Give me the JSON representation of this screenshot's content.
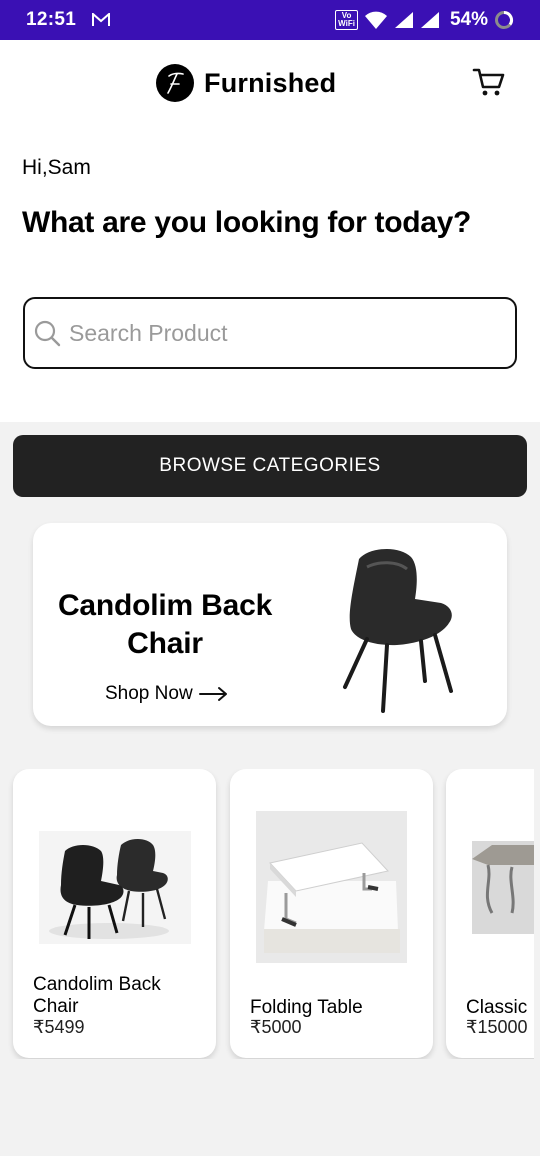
{
  "status_bar": {
    "time": "12:51",
    "network_label_top": "Vo",
    "network_label_bottom": "WiFi",
    "battery": "54%"
  },
  "header": {
    "brand": "Furnished",
    "icons": [
      "furnished-logo-icon",
      "cart-icon"
    ]
  },
  "greeting": "Hi,Sam",
  "headline": "What are you looking for today?",
  "search": {
    "placeholder": "Search Product",
    "value": ""
  },
  "browse_button": "BROWSE CATEGORIES",
  "banner": {
    "title": "Candolim Back Chair",
    "cta": "Shop Now"
  },
  "products": [
    {
      "name": "Candolim Back Chair",
      "price": "₹5499"
    },
    {
      "name": "Folding Table",
      "price": "₹5000"
    },
    {
      "name": "Classic",
      "price": "₹15000"
    }
  ],
  "colors": {
    "status_bar": "#3a10b4",
    "button": "#222222",
    "background": "#f2f2f2"
  }
}
